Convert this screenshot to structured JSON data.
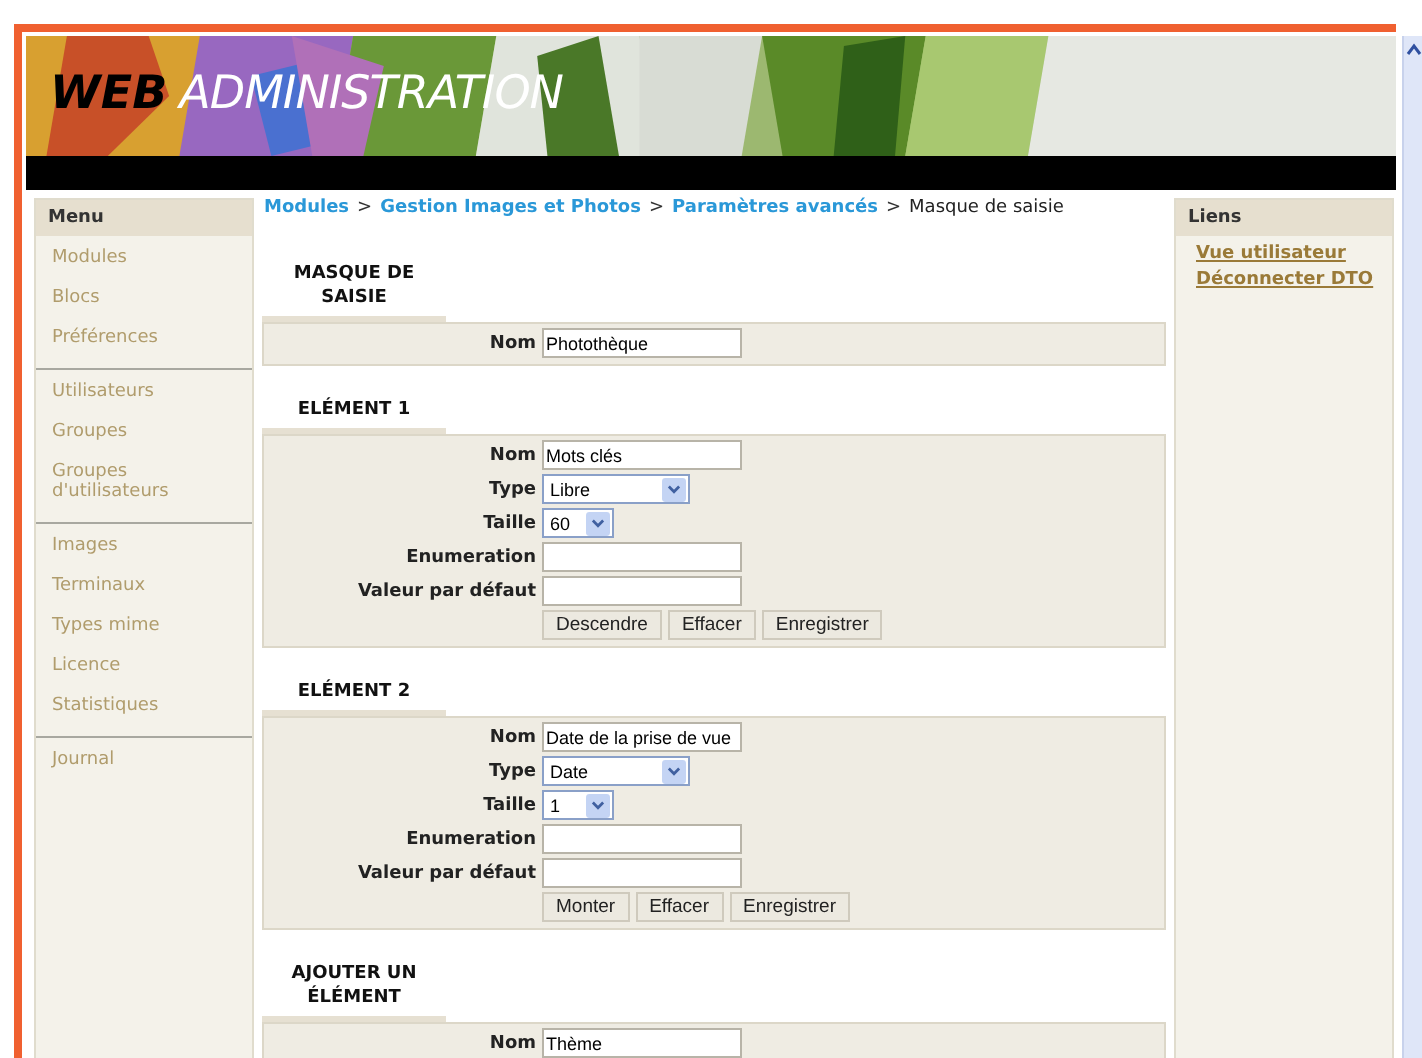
{
  "header": {
    "title_bold": "WEB",
    "title_light": "ADMINISTRATION"
  },
  "menu": {
    "title": "Menu",
    "groups": [
      {
        "items": [
          {
            "label": "Modules"
          },
          {
            "label": "Blocs"
          },
          {
            "label": "Préférences"
          }
        ]
      },
      {
        "items": [
          {
            "label": "Utilisateurs"
          },
          {
            "label": "Groupes"
          },
          {
            "label": "Groupes d'utilisateurs"
          }
        ]
      },
      {
        "items": [
          {
            "label": "Images"
          },
          {
            "label": "Terminaux"
          },
          {
            "label": "Types mime"
          },
          {
            "label": "Licence"
          },
          {
            "label": "Statistiques"
          }
        ]
      },
      {
        "items": [
          {
            "label": "Journal"
          }
        ]
      }
    ]
  },
  "breadcrumb": {
    "links": [
      "Modules",
      "Gestion Images et Photos",
      "Paramètres avancés"
    ],
    "separator": ">",
    "current": "Masque de saisie"
  },
  "sections": [
    {
      "title": "MASQUE DE SAISIE",
      "rows": [
        {
          "kind": "text",
          "label": "Nom",
          "value": "Photothèque"
        }
      ]
    },
    {
      "title": "ELÉMENT 1",
      "rows": [
        {
          "kind": "text",
          "label": "Nom",
          "value": "Mots clés"
        },
        {
          "kind": "select",
          "label": "Type",
          "value": "Libre"
        },
        {
          "kind": "short_select",
          "label": "Taille",
          "value": "60"
        },
        {
          "kind": "text",
          "label": "Enumeration"
        },
        {
          "kind": "text",
          "label": "Valeur par défaut"
        }
      ],
      "buttons": [
        "Descendre",
        "Effacer",
        "Enregistrer"
      ]
    },
    {
      "title": "ELÉMENT 2",
      "rows": [
        {
          "kind": "text",
          "label": "Nom",
          "value": "Date de la prise de vue"
        },
        {
          "kind": "select",
          "label": "Type",
          "value": "Date"
        },
        {
          "kind": "short_select",
          "label": "Taille",
          "value": "1"
        },
        {
          "kind": "text",
          "label": "Enumeration"
        },
        {
          "kind": "text",
          "label": "Valeur par défaut"
        }
      ],
      "buttons": [
        "Monter",
        "Effacer",
        "Enregistrer"
      ]
    },
    {
      "title": "AJOUTER UN ÉLÉMENT",
      "rows": [
        {
          "kind": "text",
          "label": "Nom",
          "value": "Thème"
        }
      ]
    }
  ],
  "links": {
    "title": "Liens",
    "items": [
      "Vue utilisateur",
      "Déconnecter DTO"
    ]
  }
}
